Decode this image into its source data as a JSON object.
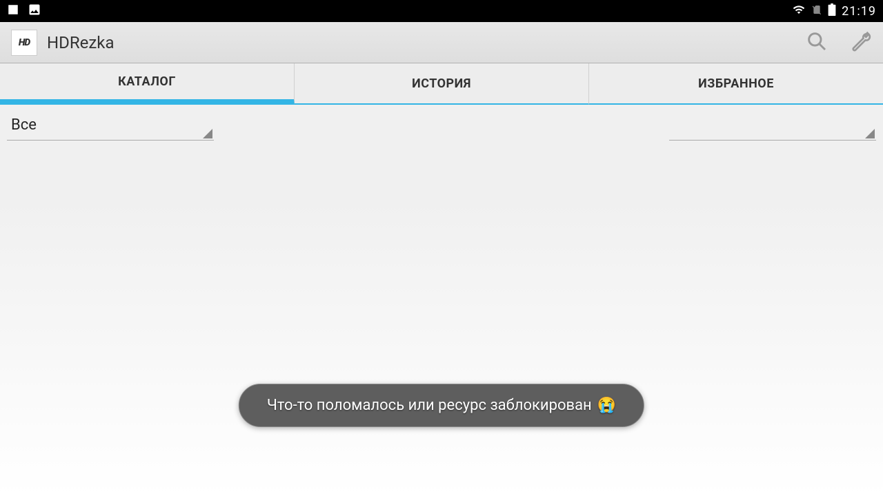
{
  "status_bar": {
    "time": "21:19"
  },
  "app_bar": {
    "logo_text": "HD",
    "title": "HDRezka"
  },
  "tabs": {
    "catalog": "КАТАЛОГ",
    "history": "ИСТОРИЯ",
    "favorites": "ИЗБРАННОЕ"
  },
  "filters": {
    "left_value": "Все",
    "right_value": ""
  },
  "toast": {
    "message": "Что-то поломалось или ресурс заблокирован",
    "emoji": "😭"
  }
}
